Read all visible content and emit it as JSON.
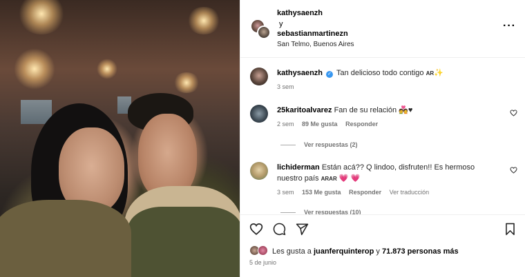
{
  "post": {
    "authors": [
      "kathysaenzh",
      "sebastianmartinezn"
    ],
    "author_joiner": "y",
    "location": "San Telmo, Buenos Aires",
    "more_icon": "more-dots-icon"
  },
  "caption": {
    "username": "kathysaenzh",
    "verified": true,
    "text": "Tan delicioso todo contigo",
    "flag": "AR",
    "emoji": "✨",
    "time": "3 sem"
  },
  "comments": [
    {
      "username": "25karitoalvarez",
      "text": "Fan de su relación",
      "emoji": "💑♥",
      "time": "2 sem",
      "likes": "89 Me gusta",
      "reply": "Responder",
      "view_replies": "Ver respuestas (2)"
    },
    {
      "username": "lichiderman",
      "text": "Están acá?? Q lindoo, disfruten!! Es hermoso",
      "text2": "nuestro país",
      "flags": "ARAR",
      "emoji": "💗 💗",
      "time": "3 sem",
      "likes": "153 Me gusta",
      "reply": "Responder",
      "translate": "Ver traducción",
      "view_replies": "Ver respuestas (10)"
    }
  ],
  "actions": {
    "like_icon": "heart-icon",
    "comment_icon": "comment-icon",
    "share_icon": "share-icon",
    "save_icon": "bookmark-icon"
  },
  "likes": {
    "prefix": "Les gusta a",
    "user": "juanferquinterop",
    "joiner": "y",
    "count": "71.873 personas más"
  },
  "date": "5 de junio"
}
